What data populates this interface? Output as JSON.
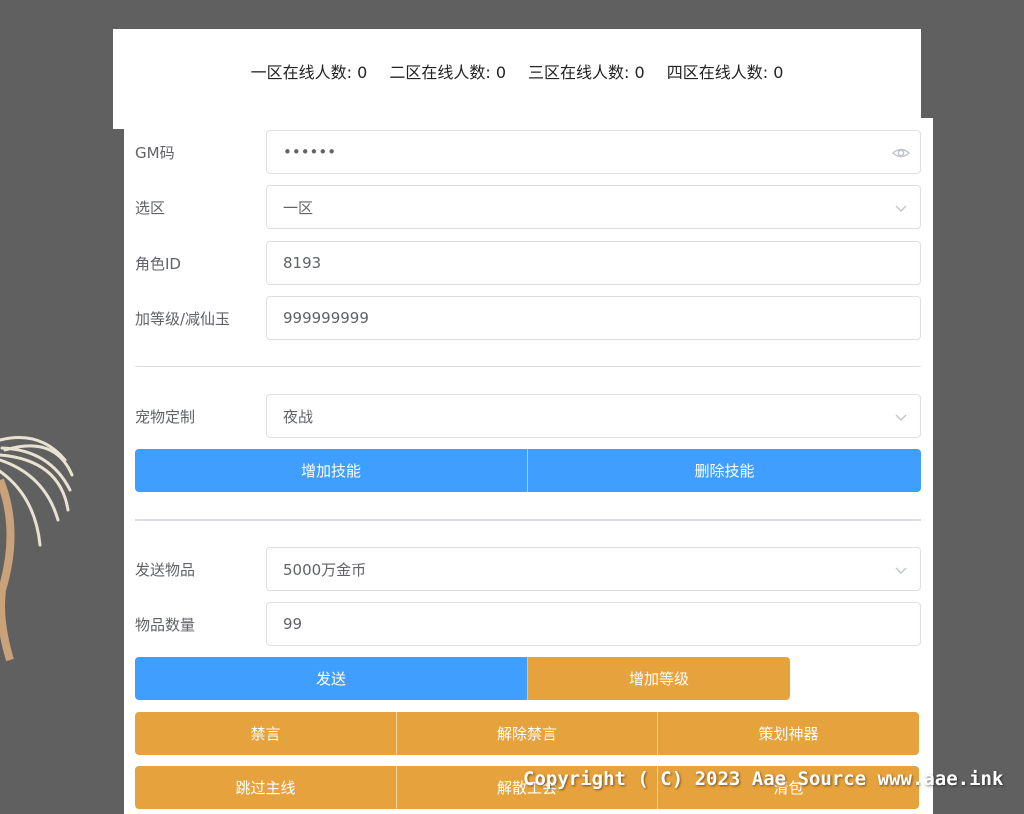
{
  "online_counts": [
    {
      "label": "一区在线人数:",
      "value": "0"
    },
    {
      "label": "二区在线人数:",
      "value": "0"
    },
    {
      "label": "三区在线人数:",
      "value": "0"
    },
    {
      "label": "四区在线人数:",
      "value": "0"
    }
  ],
  "form": {
    "gm_code": {
      "label": "GM码",
      "value": "••••••",
      "icon": "eye-icon"
    },
    "zone": {
      "label": "选区",
      "value": "一区",
      "icon": "chevron-down-icon"
    },
    "role_id": {
      "label": "角色ID",
      "value": "8193"
    },
    "level_jade": {
      "label": "加等级/减仙玉",
      "value": "999999999"
    },
    "pet": {
      "label": "宠物定制",
      "value": "夜战",
      "icon": "chevron-down-icon"
    },
    "send_item": {
      "label": "发送物品",
      "value": "5000万金币",
      "icon": "chevron-down-icon"
    },
    "item_qty": {
      "label": "物品数量",
      "value": "99"
    }
  },
  "buttons": {
    "add_skill": "增加技能",
    "remove_skill": "删除技能",
    "send": "发送",
    "add_level": "增加等级",
    "mute": "禁言",
    "unmute": "解除禁言",
    "design_artifact": "策划神器",
    "skip_main": "跳过主线",
    "disband": "解散工会",
    "clear": "清包"
  },
  "colors": {
    "primary": "#409eff",
    "warning": "#e6a23c",
    "backdrop": "#606060"
  },
  "watermark": "Copyright ( C) 2023 Aae Source www.aae.ink"
}
